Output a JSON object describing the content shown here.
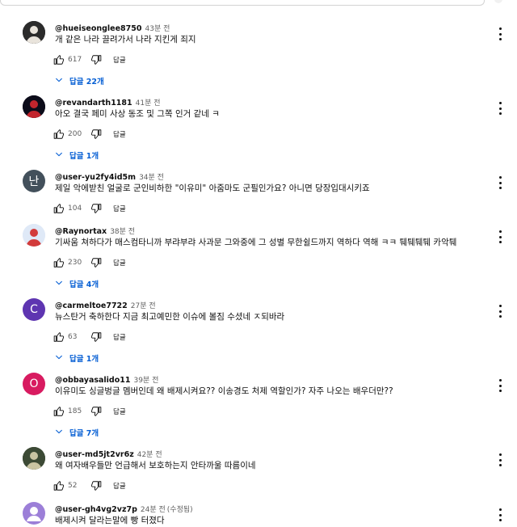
{
  "comments": [
    {
      "author": "@hueiseonglee8750",
      "time": "43분 전",
      "text": "개 같은 나라 끌려가서 나라 지킨게 죄지",
      "likes": "617",
      "reply_label": "답글",
      "replies_label": "답글 22개",
      "avatar": {
        "kind": "photo",
        "bg": "#2b2b2b",
        "fg": "#e9e4dc",
        "letter": ""
      }
    },
    {
      "author": "@revandarth1181",
      "time": "41분 전",
      "text": "아오 결국 페미 사상 동조 및 그쪽 인거 같네 ㅋ",
      "likes": "200",
      "reply_label": "답글",
      "replies_label": "답글 1개",
      "avatar": {
        "kind": "photo",
        "bg": "#0c0c1a",
        "fg": "#c2252d",
        "letter": ""
      }
    },
    {
      "author": "@user-yu2fy4id5m",
      "time": "34분 전",
      "text": "제일 악에받친 얼굴로 군인비하한 \"이유미\" 아줌마도 군필인가요? 아니면 당장입대시키죠",
      "likes": "104",
      "reply_label": "답글",
      "replies_label": "",
      "avatar": {
        "kind": "letter",
        "bg": "#43505b",
        "fg": "#ffffff",
        "letter": "난"
      }
    },
    {
      "author": "@Raynortax",
      "time": "38분 전",
      "text": "기싸움 쳐하다가 매스컴타니까 부랴부랴 사과문 그와중에 그 성별 무한쉴드까지 역하다 역해 ㅋㅋ 퉤퉤퉤퉤 카악퉤",
      "likes": "230",
      "reply_label": "답글",
      "replies_label": "답글 4개",
      "avatar": {
        "kind": "photo",
        "bg": "#dfe9f7",
        "fg": "#d23b3b",
        "letter": ""
      }
    },
    {
      "author": "@carmeltoe7722",
      "time": "27분 전",
      "text": "뉴스탄거 축하한다 지금 최고예민한 이슈에 볼짐 수셨네 ㅈ되바라",
      "likes": "63",
      "reply_label": "답글",
      "replies_label": "답글 1개",
      "avatar": {
        "kind": "letter",
        "bg": "#5e35b1",
        "fg": "#ffffff",
        "letter": "C"
      }
    },
    {
      "author": "@obbayasalido11",
      "time": "39분 전",
      "text": "이유미도 싱글벙글 멤버인데 왜 배제시켜요?? 이송경도 처제 역할인가? 자주 나오는 배우더만??",
      "likes": "185",
      "reply_label": "답글",
      "replies_label": "답글 7개",
      "avatar": {
        "kind": "letter",
        "bg": "#d81b60",
        "fg": "#ffffff",
        "letter": "O"
      }
    },
    {
      "author": "@user-md5jt2vr6z",
      "time": "42분 전",
      "text": "왜 여자배우들만 언급해서 보호하는지 안타까울 따름이네",
      "likes": "52",
      "reply_label": "답글",
      "replies_label": "",
      "avatar": {
        "kind": "photo",
        "bg": "#3c4a35",
        "fg": "#c9c4a2",
        "letter": ""
      }
    },
    {
      "author": "@user-gh4vg2vz7p",
      "time": "24분 전",
      "edited": "(수정됨)",
      "text": "배제시켜 달라는말에 빵 터졌다",
      "likes": "",
      "reply_label": "",
      "replies_label": "",
      "avatar": {
        "kind": "person",
        "bg": "#9c7fd8",
        "fg": "#ffffff",
        "letter": ""
      }
    }
  ]
}
